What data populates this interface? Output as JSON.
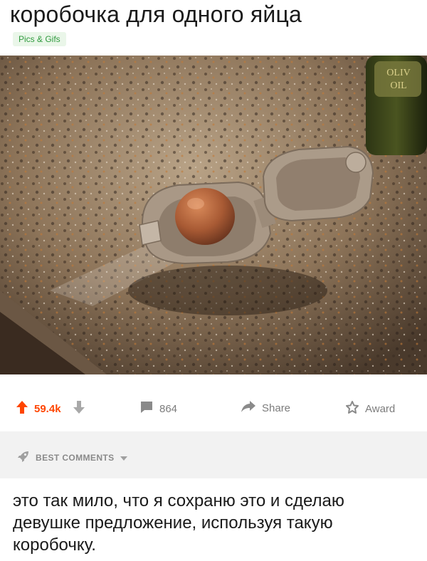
{
  "post": {
    "title": "коробочка для одного яйца",
    "flair": "Pics & Gifs"
  },
  "image": {
    "bottle_label": [
      "OLIV",
      "OIL"
    ]
  },
  "actions": {
    "upvotes": "59.4k",
    "comments": "864",
    "share": "Share",
    "award": "Award"
  },
  "best_comments": {
    "label": "BEST COMMENTS"
  },
  "comment": {
    "text": "это так мило, что я сохраню это и сделаю девушке предложение, используя такую коробочку."
  },
  "colors": {
    "upvote": "#ff4500",
    "flair_text": "#2f9a3e",
    "flair_bg": "#eaf6e9"
  }
}
